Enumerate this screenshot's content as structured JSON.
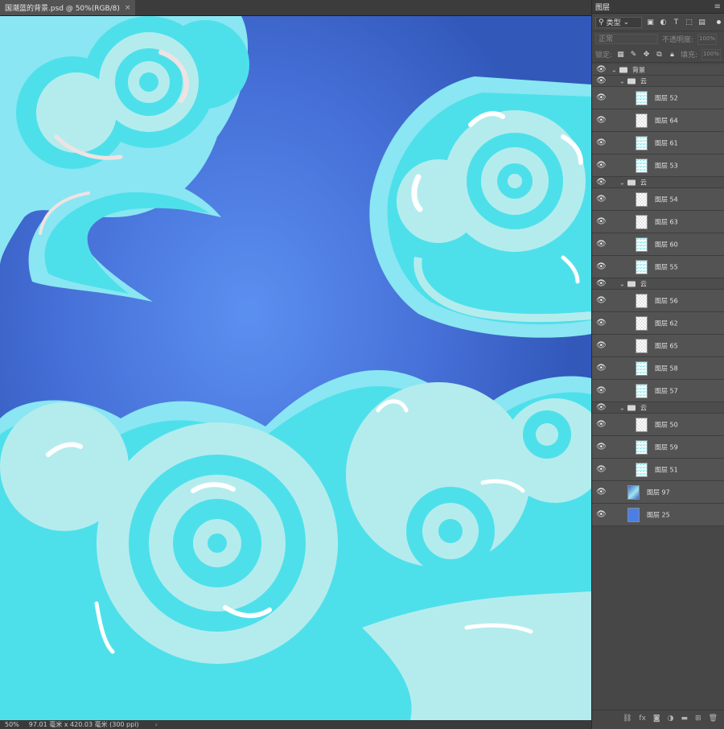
{
  "document": {
    "tab_title": "国潮蓝的背景.psd @ 50%(RGB/8)",
    "close_glyph": "×"
  },
  "status": {
    "zoom": "50%",
    "doc_size": "97.01 毫米 x 420.03 毫米 (300 ppi)",
    "arrow": "›"
  },
  "panel": {
    "tab": "图层",
    "menu_glyph": "≡",
    "filter_label": "类型",
    "blend_mode": "正常",
    "opacity_label": "不透明度:",
    "opacity_value": "100%",
    "lock_label": "锁定:",
    "fill_label": "填充:",
    "fill_value": "100%"
  },
  "layers": [
    {
      "type": "group",
      "name": "背景",
      "indent": 0
    },
    {
      "type": "group",
      "name": "云",
      "indent": 1
    },
    {
      "type": "layer",
      "name": "图层 52",
      "thumb": "clouds",
      "indent": 2
    },
    {
      "type": "layer",
      "name": "图层 64",
      "thumb": "transparent",
      "indent": 2
    },
    {
      "type": "layer",
      "name": "图层 61",
      "thumb": "clouds",
      "indent": 2
    },
    {
      "type": "layer",
      "name": "图层 53",
      "thumb": "clouds",
      "indent": 2
    },
    {
      "type": "group",
      "name": "云",
      "indent": 1
    },
    {
      "type": "layer",
      "name": "图层 54",
      "thumb": "transparent",
      "indent": 2
    },
    {
      "type": "layer",
      "name": "图层 63",
      "thumb": "transparent",
      "indent": 2
    },
    {
      "type": "layer",
      "name": "图层 60",
      "thumb": "clouds",
      "indent": 2
    },
    {
      "type": "layer",
      "name": "图层 55",
      "thumb": "clouds",
      "indent": 2
    },
    {
      "type": "group",
      "name": "云",
      "indent": 1
    },
    {
      "type": "layer",
      "name": "图层 56",
      "thumb": "transparent",
      "indent": 2
    },
    {
      "type": "layer",
      "name": "图层 62",
      "thumb": "transparent",
      "indent": 2
    },
    {
      "type": "layer",
      "name": "图层 65",
      "thumb": "transparent",
      "indent": 2
    },
    {
      "type": "layer",
      "name": "图层 58",
      "thumb": "clouds",
      "indent": 2
    },
    {
      "type": "layer",
      "name": "图层 57",
      "thumb": "clouds",
      "indent": 2
    },
    {
      "type": "group",
      "name": "云",
      "indent": 1
    },
    {
      "type": "layer",
      "name": "图层 50",
      "thumb": "transparent",
      "indent": 2
    },
    {
      "type": "layer",
      "name": "图层 59",
      "thumb": "clouds",
      "indent": 2
    },
    {
      "type": "layer",
      "name": "图层 51",
      "thumb": "clouds",
      "indent": 2
    },
    {
      "type": "layer",
      "name": "图层 97",
      "thumb": "bg-art",
      "indent": 1
    },
    {
      "type": "layer",
      "name": "图层 25",
      "thumb": "blue",
      "indent": 1
    }
  ],
  "colors": {
    "canvas_bg": "#3a63c6",
    "canvas_glow": "#5b8ff0",
    "cloud_outer": "#8ae6f2",
    "cloud_mid": "#4ee0ea",
    "cloud_light": "#b4ecee",
    "highlight": "#ffffff",
    "pink_tint": "#f0e2e2"
  },
  "icons": {
    "eye": "visibility-eye-icon",
    "folder": "folder-icon",
    "link": "link-layers-icon",
    "fx": "fx-icon",
    "mask": "add-mask-icon",
    "adjust": "adjustment-layer-icon",
    "new_group": "new-group-icon",
    "new_layer": "new-layer-icon",
    "trash": "trash-icon"
  }
}
